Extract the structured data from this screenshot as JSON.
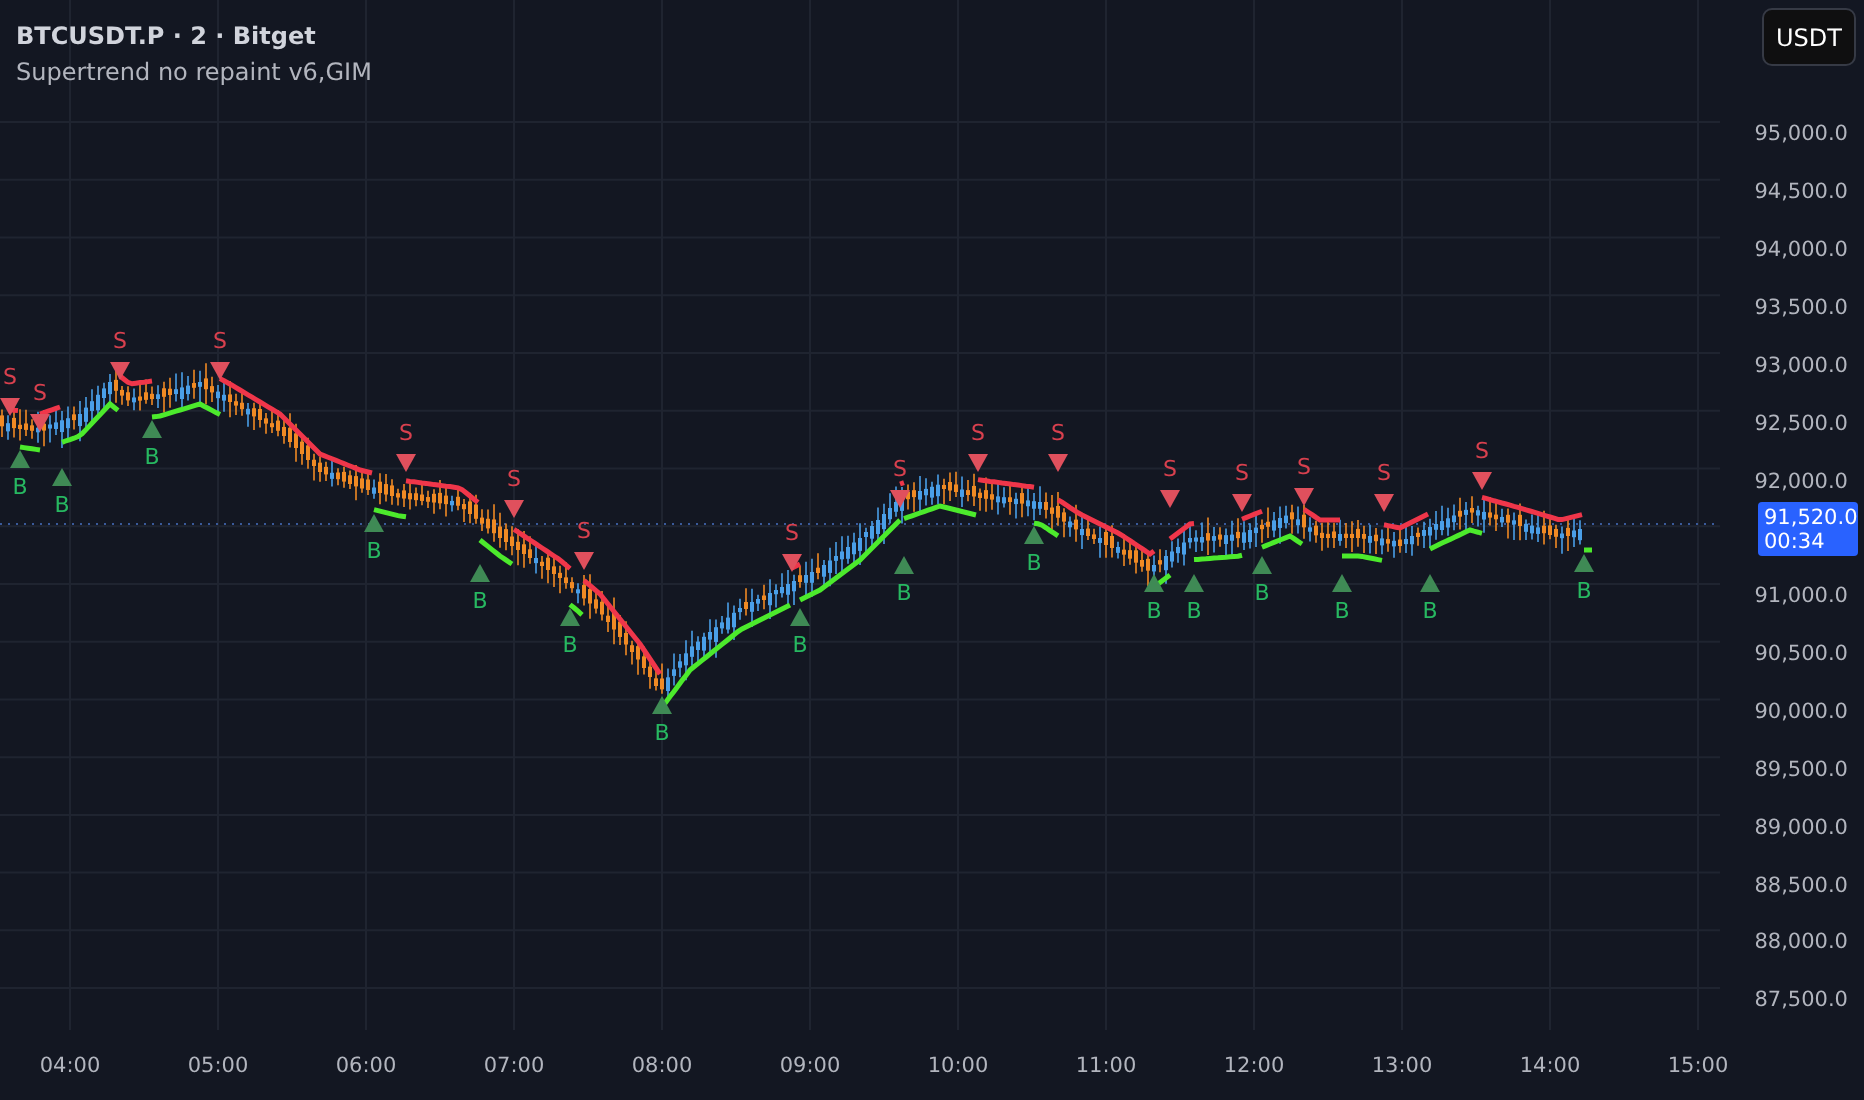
{
  "symbol_title": "BTCUSDT.P · 2 · Bitget",
  "indicator": "Supertrend no repaint v6,GIM",
  "currency_button": "USDT",
  "price_axis": [
    "95,000.0",
    "94,500.0",
    "94,000.0",
    "93,500.0",
    "93,000.0",
    "92,500.0",
    "92,000.0",
    "91,000.0",
    "90,500.0",
    "90,000.0",
    "89,500.0",
    "89,000.0",
    "88,500.0",
    "88,000.0",
    "87,500.0"
  ],
  "last_price": {
    "price": "91,520.0",
    "countdown": "00:34"
  },
  "time_axis": [
    "04:00",
    "05:00",
    "06:00",
    "07:00",
    "08:00",
    "09:00",
    "10:00",
    "11:00",
    "12:00",
    "13:00",
    "14:00",
    "15:00"
  ],
  "signals": [
    {
      "kind": "sell",
      "label": "S"
    },
    {
      "kind": "buy",
      "label": "B"
    },
    {
      "kind": "sell",
      "label": "S"
    },
    {
      "kind": "buy",
      "label": "B"
    },
    {
      "kind": "sell",
      "label": "S"
    },
    {
      "kind": "buy",
      "label": "B"
    },
    {
      "kind": "sell",
      "label": "S"
    },
    {
      "kind": "buy",
      "label": "B"
    },
    {
      "kind": "sell",
      "label": "S"
    },
    {
      "kind": "buy",
      "label": "B"
    },
    {
      "kind": "sell",
      "label": "S"
    },
    {
      "kind": "buy",
      "label": "B"
    },
    {
      "kind": "sell",
      "label": "S"
    },
    {
      "kind": "buy",
      "label": "B"
    },
    {
      "kind": "sell",
      "label": "S"
    },
    {
      "kind": "buy",
      "label": "B"
    },
    {
      "kind": "sell",
      "label": "S"
    },
    {
      "kind": "buy",
      "label": "B"
    },
    {
      "kind": "sell",
      "label": "S"
    },
    {
      "kind": "buy",
      "label": "B"
    },
    {
      "kind": "sell",
      "label": "S"
    },
    {
      "kind": "buy",
      "label": "B"
    },
    {
      "kind": "sell",
      "label": "S"
    },
    {
      "kind": "buy",
      "label": "B"
    },
    {
      "kind": "sell",
      "label": "S"
    },
    {
      "kind": "buy",
      "label": "B"
    },
    {
      "kind": "sell",
      "label": "S"
    },
    {
      "kind": "buy",
      "label": "B"
    },
    {
      "kind": "sell",
      "label": "S"
    },
    {
      "kind": "buy",
      "label": "B"
    },
    {
      "kind": "sell",
      "label": "S"
    },
    {
      "kind": "buy",
      "label": "B"
    }
  ]
}
